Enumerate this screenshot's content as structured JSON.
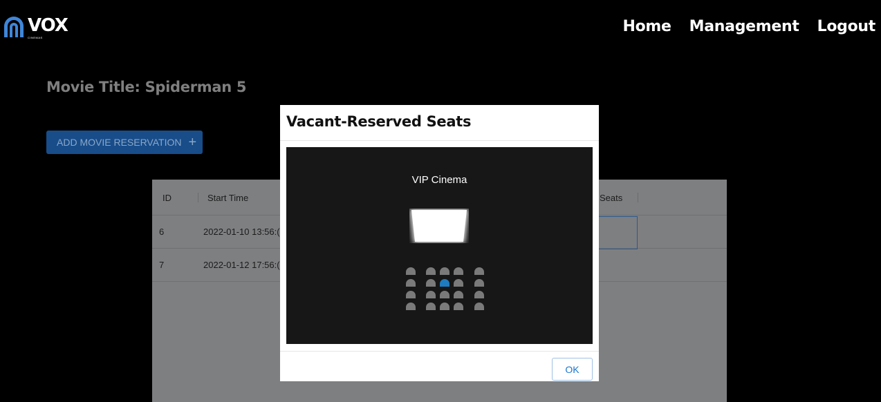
{
  "nav": {
    "logo": {
      "word": "VOX",
      "sub": "CINEMAS"
    },
    "links": [
      "Home",
      "Management",
      "Logout"
    ]
  },
  "page": {
    "title": "Movie Title: Spiderman 5",
    "add_button": {
      "label": "ADD MOVIE RESERVATION",
      "icon": "plus-icon"
    }
  },
  "table": {
    "columns": [
      "ID",
      "Start Time",
      "Seats"
    ],
    "rows": [
      {
        "id": "6",
        "start_time": "2022-01-10 13:56:("
      },
      {
        "id": "7",
        "start_time": "2022-01-12 17:56:("
      }
    ]
  },
  "modal": {
    "title": "Vacant-Reserved Seats",
    "cinema_name": "VIP Cinema",
    "seat_legend_colors": {
      "vacant": "#7a7a7a",
      "reserved": "#1f7bbf"
    },
    "seat_rows": [
      [
        "vacant",
        "vacant",
        "vacant",
        "vacant",
        "vacant"
      ],
      [
        "vacant",
        "vacant",
        "reserved",
        "vacant",
        "vacant"
      ],
      [
        "vacant",
        "vacant",
        "vacant",
        "vacant",
        "vacant"
      ],
      [
        "vacant",
        "vacant",
        "vacant",
        "vacant",
        "vacant"
      ]
    ],
    "ok_label": "OK"
  },
  "colors": {
    "primary_button": "#184d8a",
    "accent_blue": "#1976d2",
    "logo_blue": "#3f86d9"
  }
}
